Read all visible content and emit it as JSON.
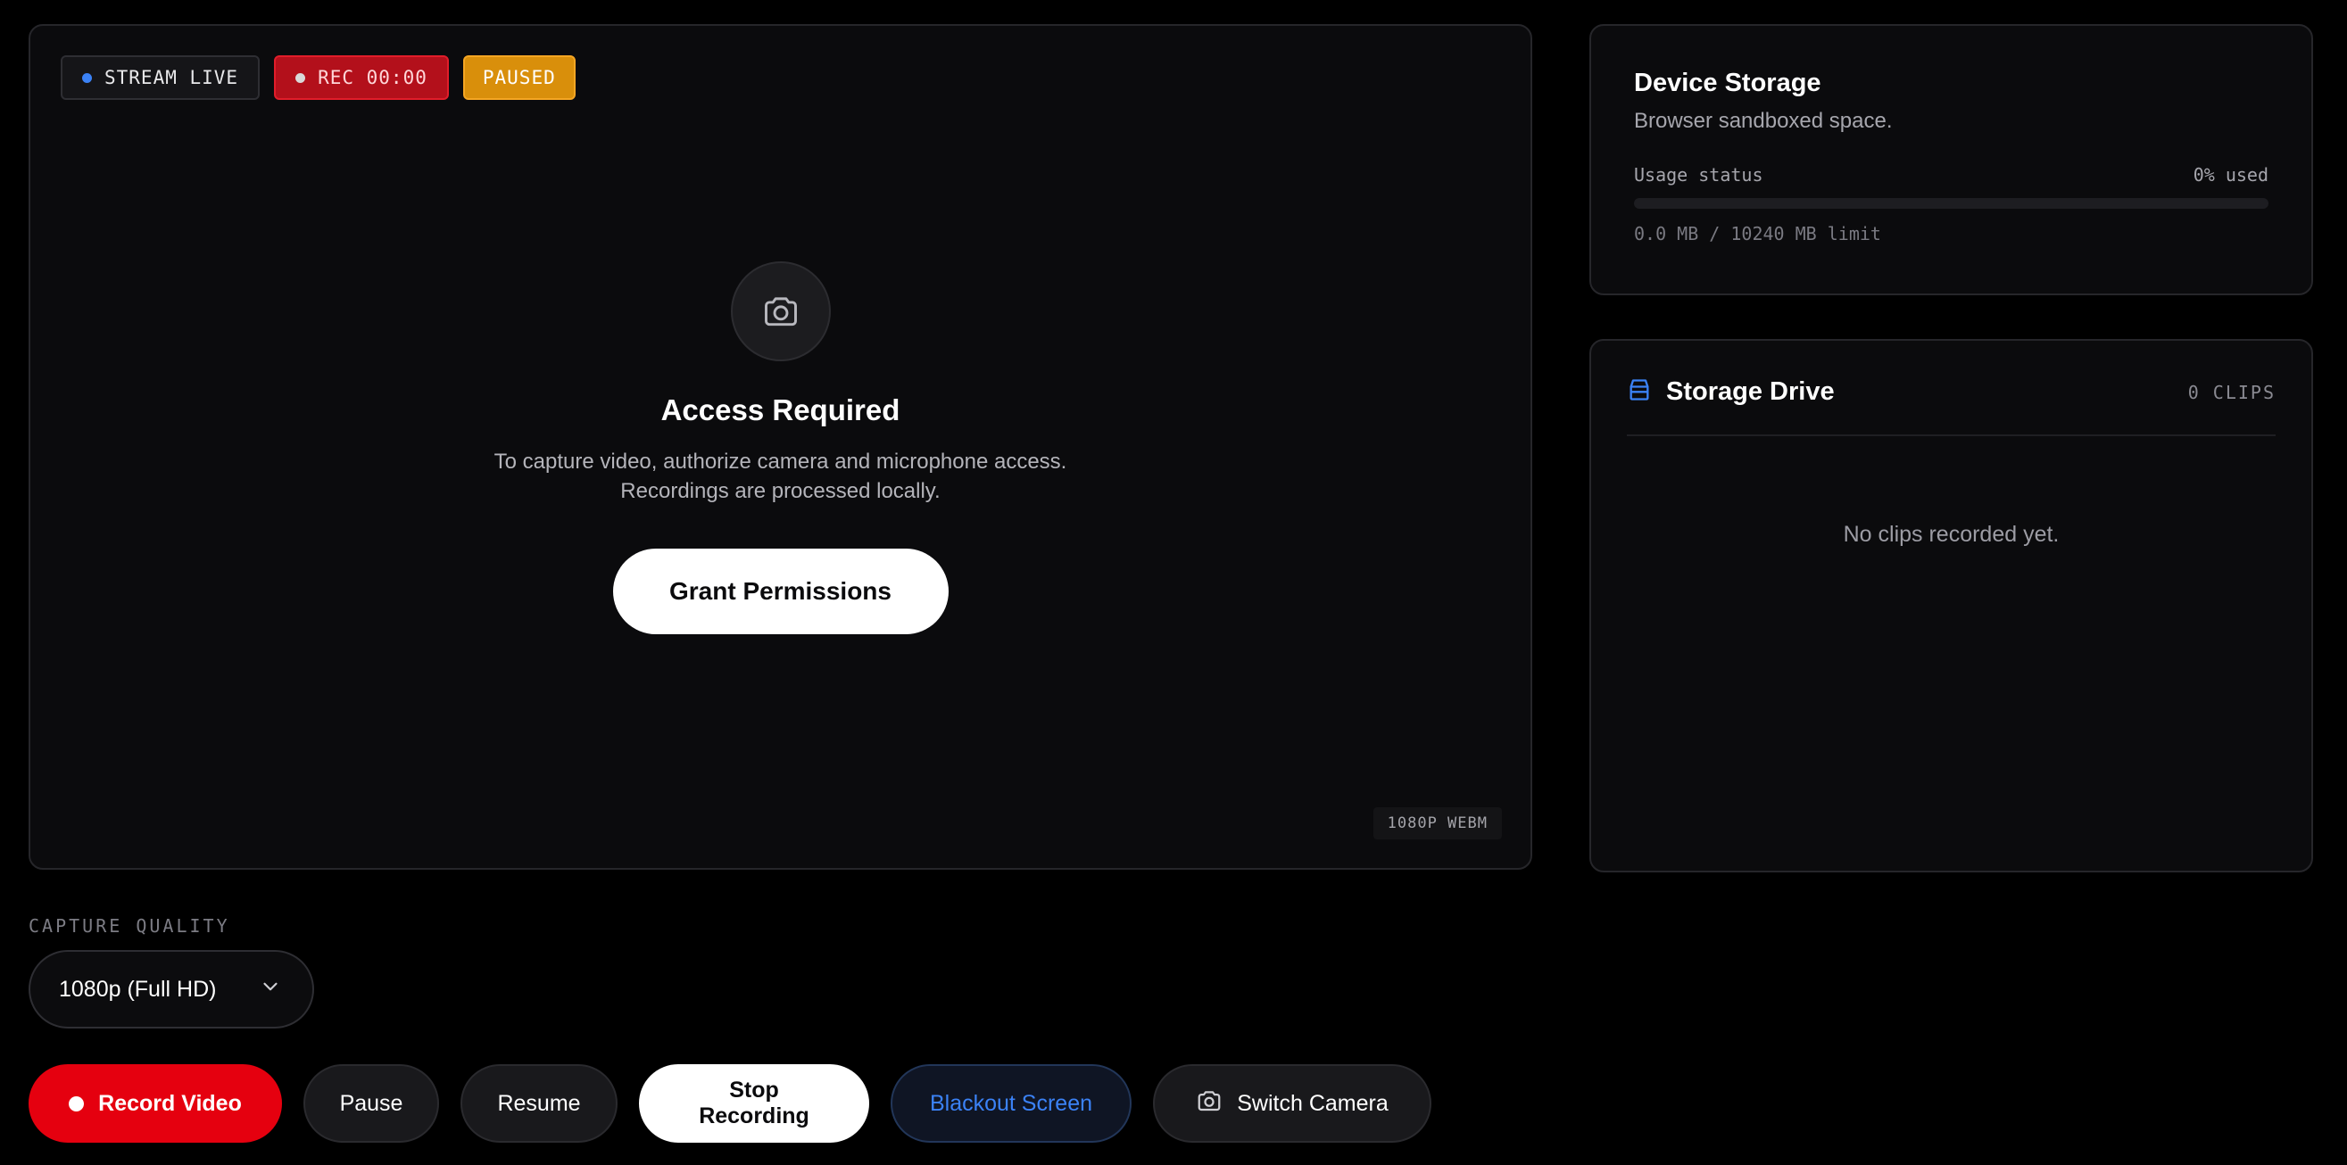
{
  "preview": {
    "badges": {
      "live": "STREAM LIVE",
      "rec": "REC 00:00",
      "paused": "PAUSED"
    },
    "empty_state": {
      "icon": "camera-icon",
      "title": "Access Required",
      "description_line1": "To capture video, authorize camera and microphone access.",
      "description_line2": "Recordings are processed locally.",
      "button_label": "Grant Permissions"
    },
    "format_tag": "1080P WEBM"
  },
  "storage": {
    "title": "Device Storage",
    "subtitle": "Browser sandboxed space.",
    "usage_label": "Usage status",
    "usage_value": "0% used",
    "usage_percent": 0,
    "usage_limit": "0.0 MB / 10240 MB limit"
  },
  "drive": {
    "icon": "storage-drive-icon",
    "title": "Storage Drive",
    "count": "0 CLIPS",
    "empty_message": "No clips recorded yet."
  },
  "quality": {
    "label": "CAPTURE QUALITY",
    "selected": "1080p (Full HD)"
  },
  "controls": {
    "record": "Record Video",
    "pause": "Pause",
    "resume": "Resume",
    "stop": "Stop Recording",
    "blackout": "Blackout Screen",
    "switch_camera": "Switch Camera"
  },
  "colors": {
    "accent_blue": "#3b82f6",
    "record_red": "#e5000f",
    "paused_amber": "#d98f0b",
    "background": "#000000",
    "panel": "#0b0b0d"
  }
}
